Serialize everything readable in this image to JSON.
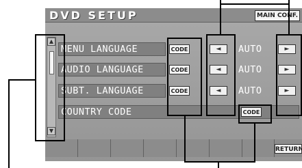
{
  "screen": {
    "title": "DVD SETUP",
    "main_conf_label": "MAIN CONF.",
    "return_label": "RETURN"
  },
  "rows": [
    {
      "label": "MENU LANGUAGE",
      "code_label": "CODE",
      "value": "AUTO",
      "left_arrow": "◄",
      "right_arrow": "►"
    },
    {
      "label": "AUDIO LANGUAGE",
      "code_label": "CODE",
      "value": "AUTO",
      "left_arrow": "◄",
      "right_arrow": "►"
    },
    {
      "label": "SUBT. LANGUAGE",
      "code_label": "CODE",
      "value": "AUTO",
      "left_arrow": "◄",
      "right_arrow": "►"
    },
    {
      "label": "COUNTRY CODE",
      "code_label": "CODE"
    }
  ],
  "scroll": {
    "up_icon": "▲",
    "down_icon": "▼"
  }
}
